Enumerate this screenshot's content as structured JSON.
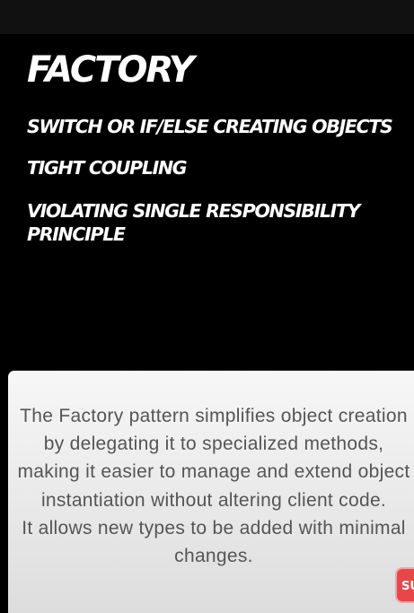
{
  "slide": {
    "title": "FACTORY",
    "bullets": [
      "SWITCH OR IF/ELSE CREATING OBJECTS",
      "TIGHT COUPLING",
      "VIOLATING SINGLE RESPONSIBILITY PRINCIPLE"
    ]
  },
  "description": {
    "line1": "The Factory pattern simplifies object creation by delegating it to specialized methods, making it easier to manage and extend object instantiation without altering client code.",
    "line2": "It allows new types to be added with minimal changes."
  },
  "subscribe": {
    "label": "SU"
  },
  "colors": {
    "background": "#000000",
    "top_bar": "#111111",
    "title_text": "#ffffff",
    "card_background": "#efefef",
    "card_text": "#555555",
    "subscribe_red": "#e8474a"
  }
}
